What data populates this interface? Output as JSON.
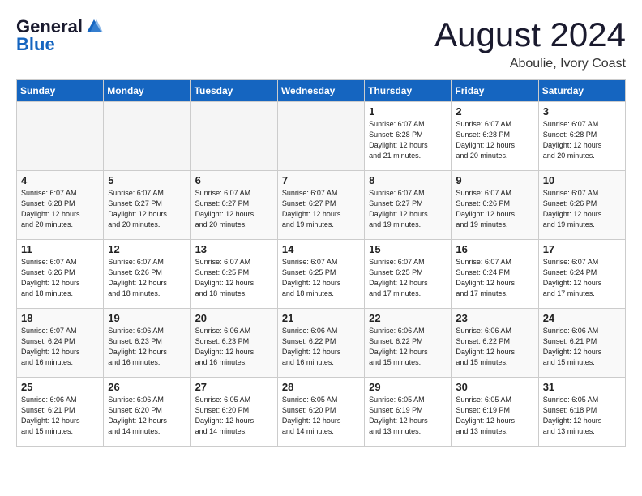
{
  "logo": {
    "general": "General",
    "blue": "Blue"
  },
  "title": "August 2024",
  "location": "Aboulie, Ivory Coast",
  "days_of_week": [
    "Sunday",
    "Monday",
    "Tuesday",
    "Wednesday",
    "Thursday",
    "Friday",
    "Saturday"
  ],
  "weeks": [
    [
      {
        "num": "",
        "empty": true
      },
      {
        "num": "",
        "empty": true
      },
      {
        "num": "",
        "empty": true
      },
      {
        "num": "",
        "empty": true
      },
      {
        "num": "1",
        "sunrise": "6:07 AM",
        "sunset": "6:28 PM",
        "daylight": "12 hours and 21 minutes."
      },
      {
        "num": "2",
        "sunrise": "6:07 AM",
        "sunset": "6:28 PM",
        "daylight": "12 hours and 20 minutes."
      },
      {
        "num": "3",
        "sunrise": "6:07 AM",
        "sunset": "6:28 PM",
        "daylight": "12 hours and 20 minutes."
      }
    ],
    [
      {
        "num": "4",
        "sunrise": "6:07 AM",
        "sunset": "6:28 PM",
        "daylight": "12 hours and 20 minutes."
      },
      {
        "num": "5",
        "sunrise": "6:07 AM",
        "sunset": "6:27 PM",
        "daylight": "12 hours and 20 minutes."
      },
      {
        "num": "6",
        "sunrise": "6:07 AM",
        "sunset": "6:27 PM",
        "daylight": "12 hours and 20 minutes."
      },
      {
        "num": "7",
        "sunrise": "6:07 AM",
        "sunset": "6:27 PM",
        "daylight": "12 hours and 19 minutes."
      },
      {
        "num": "8",
        "sunrise": "6:07 AM",
        "sunset": "6:27 PM",
        "daylight": "12 hours and 19 minutes."
      },
      {
        "num": "9",
        "sunrise": "6:07 AM",
        "sunset": "6:26 PM",
        "daylight": "12 hours and 19 minutes."
      },
      {
        "num": "10",
        "sunrise": "6:07 AM",
        "sunset": "6:26 PM",
        "daylight": "12 hours and 19 minutes."
      }
    ],
    [
      {
        "num": "11",
        "sunrise": "6:07 AM",
        "sunset": "6:26 PM",
        "daylight": "12 hours and 18 minutes."
      },
      {
        "num": "12",
        "sunrise": "6:07 AM",
        "sunset": "6:26 PM",
        "daylight": "12 hours and 18 minutes."
      },
      {
        "num": "13",
        "sunrise": "6:07 AM",
        "sunset": "6:25 PM",
        "daylight": "12 hours and 18 minutes."
      },
      {
        "num": "14",
        "sunrise": "6:07 AM",
        "sunset": "6:25 PM",
        "daylight": "12 hours and 18 minutes."
      },
      {
        "num": "15",
        "sunrise": "6:07 AM",
        "sunset": "6:25 PM",
        "daylight": "12 hours and 17 minutes."
      },
      {
        "num": "16",
        "sunrise": "6:07 AM",
        "sunset": "6:24 PM",
        "daylight": "12 hours and 17 minutes."
      },
      {
        "num": "17",
        "sunrise": "6:07 AM",
        "sunset": "6:24 PM",
        "daylight": "12 hours and 17 minutes."
      }
    ],
    [
      {
        "num": "18",
        "sunrise": "6:07 AM",
        "sunset": "6:24 PM",
        "daylight": "12 hours and 16 minutes."
      },
      {
        "num": "19",
        "sunrise": "6:06 AM",
        "sunset": "6:23 PM",
        "daylight": "12 hours and 16 minutes."
      },
      {
        "num": "20",
        "sunrise": "6:06 AM",
        "sunset": "6:23 PM",
        "daylight": "12 hours and 16 minutes."
      },
      {
        "num": "21",
        "sunrise": "6:06 AM",
        "sunset": "6:22 PM",
        "daylight": "12 hours and 16 minutes."
      },
      {
        "num": "22",
        "sunrise": "6:06 AM",
        "sunset": "6:22 PM",
        "daylight": "12 hours and 15 minutes."
      },
      {
        "num": "23",
        "sunrise": "6:06 AM",
        "sunset": "6:22 PM",
        "daylight": "12 hours and 15 minutes."
      },
      {
        "num": "24",
        "sunrise": "6:06 AM",
        "sunset": "6:21 PM",
        "daylight": "12 hours and 15 minutes."
      }
    ],
    [
      {
        "num": "25",
        "sunrise": "6:06 AM",
        "sunset": "6:21 PM",
        "daylight": "12 hours and 15 minutes."
      },
      {
        "num": "26",
        "sunrise": "6:06 AM",
        "sunset": "6:20 PM",
        "daylight": "12 hours and 14 minutes."
      },
      {
        "num": "27",
        "sunrise": "6:05 AM",
        "sunset": "6:20 PM",
        "daylight": "12 hours and 14 minutes."
      },
      {
        "num": "28",
        "sunrise": "6:05 AM",
        "sunset": "6:20 PM",
        "daylight": "12 hours and 14 minutes."
      },
      {
        "num": "29",
        "sunrise": "6:05 AM",
        "sunset": "6:19 PM",
        "daylight": "12 hours and 13 minutes."
      },
      {
        "num": "30",
        "sunrise": "6:05 AM",
        "sunset": "6:19 PM",
        "daylight": "12 hours and 13 minutes."
      },
      {
        "num": "31",
        "sunrise": "6:05 AM",
        "sunset": "6:18 PM",
        "daylight": "12 hours and 13 minutes."
      }
    ]
  ],
  "labels": {
    "sunrise": "Sunrise:",
    "sunset": "Sunset:",
    "daylight": "Daylight:"
  }
}
